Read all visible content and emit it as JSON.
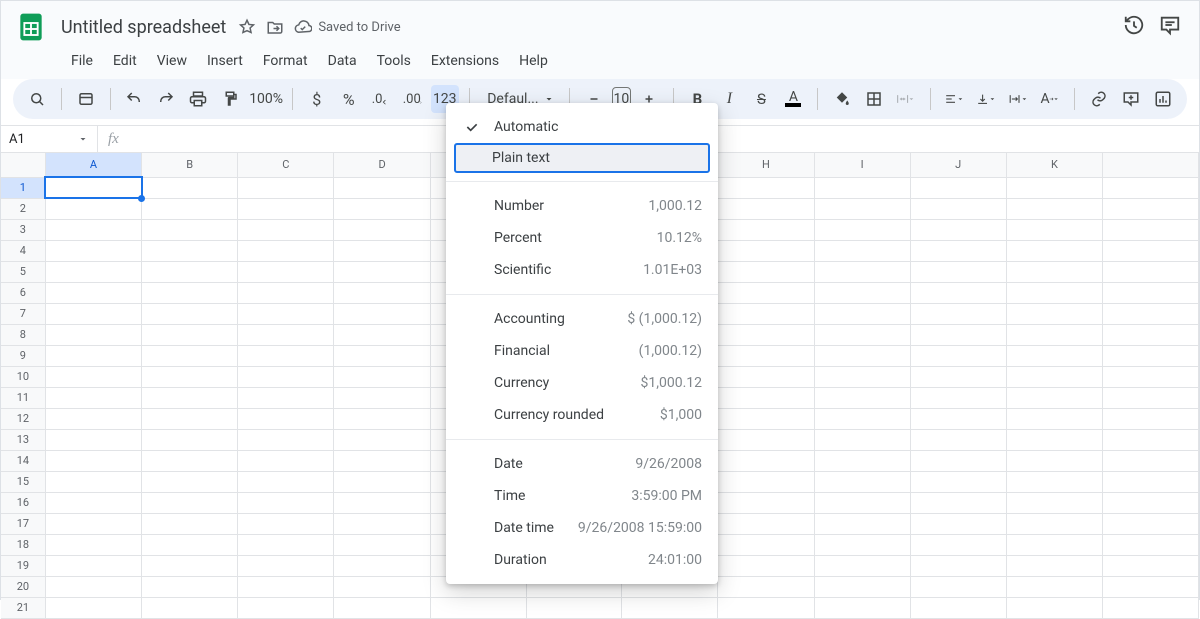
{
  "header": {
    "title": "Untitled spreadsheet",
    "saved_label": "Saved to Drive",
    "menus": [
      "File",
      "Edit",
      "View",
      "Insert",
      "Format",
      "Data",
      "Tools",
      "Extensions",
      "Help"
    ]
  },
  "toolbar": {
    "zoom": "100%",
    "num_format_btn": "123",
    "font_name": "Defaul...",
    "font_size": "10"
  },
  "namebox": {
    "cell": "A1"
  },
  "grid": {
    "columns": [
      "A",
      "B",
      "C",
      "D",
      "",
      "",
      "",
      "H",
      "I",
      "J",
      "K",
      ""
    ],
    "rows": [
      "1",
      "2",
      "3",
      "4",
      "5",
      "6",
      "7",
      "8",
      "9",
      "10",
      "11",
      "12",
      "13",
      "14",
      "15",
      "16",
      "17",
      "18",
      "19",
      "20",
      "21"
    ],
    "active_cell": {
      "row": 0,
      "col": 0
    }
  },
  "format_menu": {
    "groups": [
      [
        {
          "l": "Automatic",
          "s": "",
          "checked": true
        },
        {
          "l": "Plain text",
          "s": "",
          "highlight": true
        }
      ],
      [
        {
          "l": "Number",
          "s": "1,000.12"
        },
        {
          "l": "Percent",
          "s": "10.12%"
        },
        {
          "l": "Scientific",
          "s": "1.01E+03"
        }
      ],
      [
        {
          "l": "Accounting",
          "s": "$ (1,000.12)"
        },
        {
          "l": "Financial",
          "s": "(1,000.12)"
        },
        {
          "l": "Currency",
          "s": "$1,000.12"
        },
        {
          "l": "Currency rounded",
          "s": "$1,000"
        }
      ],
      [
        {
          "l": "Date",
          "s": "9/26/2008"
        },
        {
          "l": "Time",
          "s": "3:59:00 PM"
        },
        {
          "l": "Date time",
          "s": "9/26/2008 15:59:00"
        },
        {
          "l": "Duration",
          "s": "24:01:00"
        }
      ]
    ]
  }
}
